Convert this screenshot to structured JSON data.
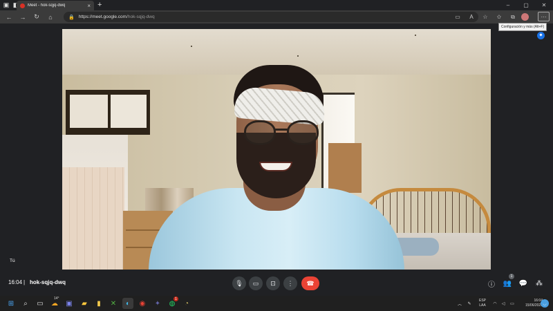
{
  "browser": {
    "tab": {
      "title": "Meet - hok-sqjq-dwq",
      "close": "×"
    },
    "new_tab": "+",
    "window_controls": {
      "minimize": "–",
      "maximize": "▢",
      "close": "✕"
    },
    "address": {
      "host": "https://meet.google.com",
      "path": "/hok-sqjq-dwq"
    },
    "menu_button": "···",
    "tooltip": "Configuración y más (Alt+F)"
  },
  "meet": {
    "self_label": "Tú",
    "time": "16:04",
    "separator": "|",
    "meeting_code": "hok-sqjq-dwq",
    "people_count": "1"
  },
  "taskbar": {
    "weather_temp": "14°",
    "whatsapp_badge": "1",
    "language": {
      "line1": "ESP",
      "line2": "LAA"
    },
    "time": "16:04",
    "date": "15/06/2022"
  },
  "icons": {
    "tab_favicon": "recording-dot-icon",
    "meet_badge": "meet-extension-icon"
  },
  "colors": {
    "end_call": "#ea4335",
    "meet_accent": "#1a73e8",
    "background": "#202124"
  }
}
